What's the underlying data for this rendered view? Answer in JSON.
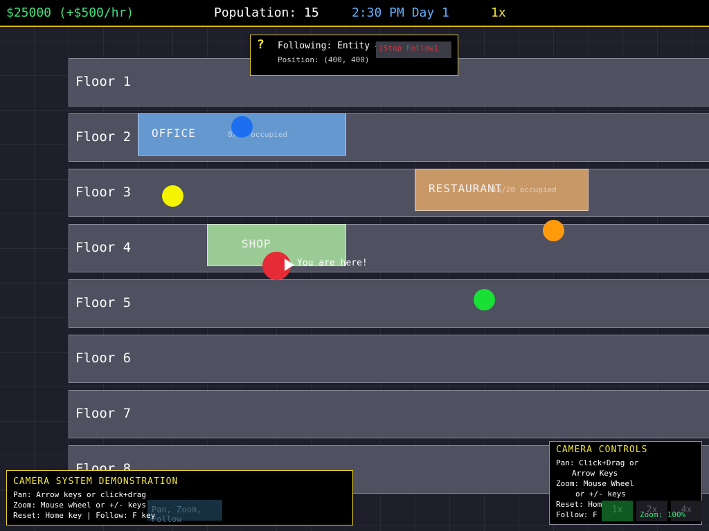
{
  "hud": {
    "money": "$25000 (+$500/hr)",
    "population": "Population: 15",
    "time": "2:30 PM Day 1",
    "speed": "1x"
  },
  "floors": [
    "Floor 1",
    "Floor 2",
    "Floor 3",
    "Floor 4",
    "Floor 5",
    "Floor 6",
    "Floor 7",
    "Floor 8"
  ],
  "rooms": {
    "office": {
      "name": "OFFICE",
      "occupancy": "8/10 occupied",
      "color": "#6598cf"
    },
    "restaurant": {
      "name": "RESTAURANT",
      "occupancy": "15/20 occupied",
      "color": "#c99867"
    },
    "shop": {
      "name": "SHOP",
      "color": "#9acb94"
    }
  },
  "entities": [
    {
      "id": "blue",
      "color": "#1e6ff0"
    },
    {
      "id": "yellow",
      "color": "#f4f400"
    },
    {
      "id": "orange",
      "color": "#ff9a0a"
    },
    {
      "id": "red",
      "color": "#e52b36"
    },
    {
      "id": "green",
      "color": "#18e034"
    }
  ],
  "marker": {
    "text": "You are here!"
  },
  "follow": {
    "icon": "?",
    "title": "Following: Entity #42",
    "position": "Position: (400, 400)",
    "stop_label": "[Stop Follow]"
  },
  "demo": {
    "title": "CAMERA SYSTEM DEMONSTRATION",
    "lines": [
      "Pan: Arrow keys or click+drag",
      "Zoom: Mouse wheel or +/- keys",
      "Reset: Home key | Follow: F key"
    ],
    "button_label": "Pan, Zoom, Follow"
  },
  "camera": {
    "title": "CAMERA CONTROLS",
    "lines": [
      "Pan: Click+Drag or",
      "Arrow Keys",
      "Zoom: Mouse Wheel",
      "or +/- keys",
      "Reset: Home",
      "Follow: F"
    ],
    "zoom_buttons": [
      "1x",
      "2x",
      "4x"
    ],
    "zoom_indicator": "Zoom: 100%"
  }
}
